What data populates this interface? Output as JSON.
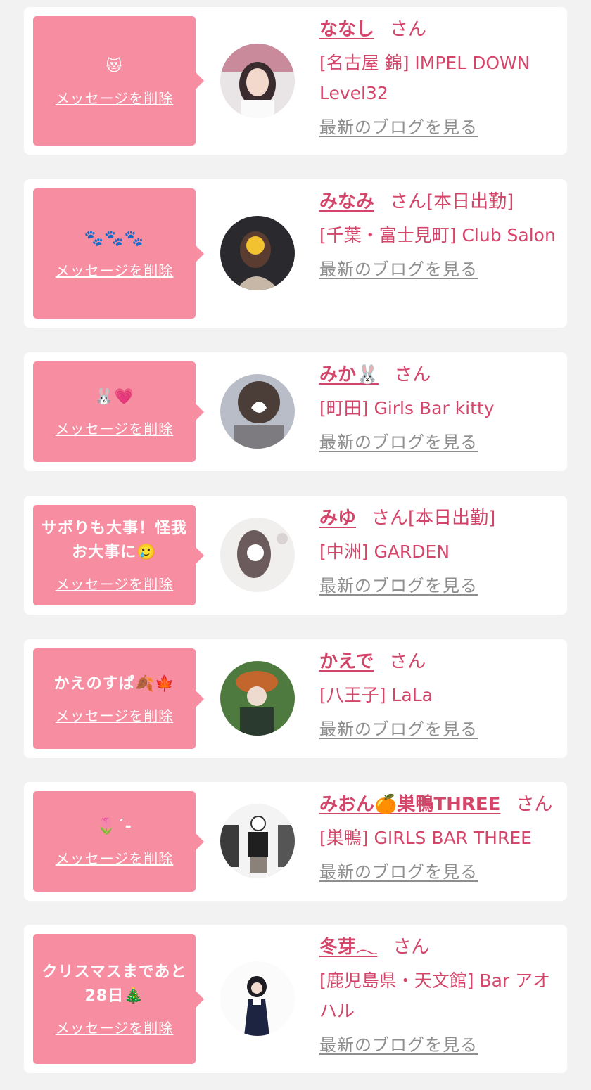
{
  "items": [
    {
      "bubble_text": "😻",
      "delete_label": "メッセージを削除",
      "name": "ななし",
      "suffix": "さん",
      "shop": "[名古屋 錦] IMPEL DOWN Level32",
      "blog_label": "最新のブログを見る"
    },
    {
      "bubble_text": "🐾🐾🐾",
      "delete_label": "メッセージを削除",
      "name": "みなみ",
      "suffix": "さん[本日出勤]",
      "shop": "[千葉・富士見町] Club Salon",
      "blog_label": "最新のブログを見る"
    },
    {
      "bubble_text": "🐰💗",
      "delete_label": "メッセージを削除",
      "name": "みか🐰",
      "suffix": "さん",
      "shop": "[町田] Girls Bar kitty",
      "blog_label": "最新のブログを見る"
    },
    {
      "bubble_text": "サボりも大事！怪我お大事に🥲",
      "delete_label": "メッセージを削除",
      "name": "みゆ",
      "suffix": "さん[本日出勤]",
      "shop": "[中洲] GARDEN",
      "blog_label": "最新のブログを見る"
    },
    {
      "bubble_text": "かえのすぱ🍂🍁",
      "delete_label": "メッセージを削除",
      "name": "かえで",
      "suffix": "さん",
      "shop": "[八王子] LaLa",
      "blog_label": "最新のブログを見る"
    },
    {
      "bubble_text": "🌷´-",
      "delete_label": "メッセージを削除",
      "name": "みおん🍊巣鴨THREE",
      "suffix": "さん",
      "shop": "[巣鴨] GIRLS BAR THREE",
      "blog_label": "最新のブログを見る"
    },
    {
      "bubble_text": "クリスマスまであと28日🎄",
      "delete_label": "メッセージを削除",
      "name": "冬芽𓂃",
      "suffix": "さん",
      "shop": "[鹿児島県・天文館] Bar アオハル",
      "blog_label": "最新のブログを見る"
    }
  ]
}
